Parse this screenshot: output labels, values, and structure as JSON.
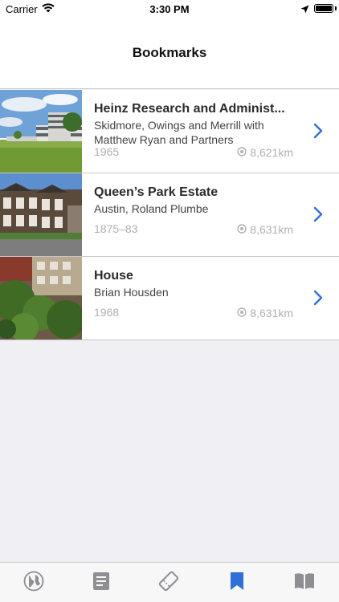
{
  "status_bar": {
    "carrier": "Carrier",
    "time": "3:30 PM"
  },
  "nav": {
    "title": "Bookmarks"
  },
  "bookmarks": [
    {
      "title": "Heinz Research and Administ...",
      "subtitle": "Skidmore, Owings and Merrill with Matthew Ryan and Partners",
      "year": "1965",
      "distance": "8,621km"
    },
    {
      "title": "Queen’s Park Estate",
      "subtitle": "Austin, Roland Plumbe",
      "year": "1875–83",
      "distance": "8,631km"
    },
    {
      "title": "House",
      "subtitle": "Brian Housden",
      "year": "1968",
      "distance": "8,631km"
    }
  ],
  "tab_bar": {
    "tabs": [
      {
        "icon": "globe-icon",
        "active": false
      },
      {
        "icon": "list-icon",
        "active": false
      },
      {
        "icon": "ticket-icon",
        "active": false
      },
      {
        "icon": "bookmark-icon",
        "active": true
      },
      {
        "icon": "book-icon",
        "active": false
      }
    ]
  },
  "colors": {
    "accent": "#2f6fd6",
    "inactive_tab": "#8e8e93",
    "meta_text": "#b0b0b0"
  }
}
